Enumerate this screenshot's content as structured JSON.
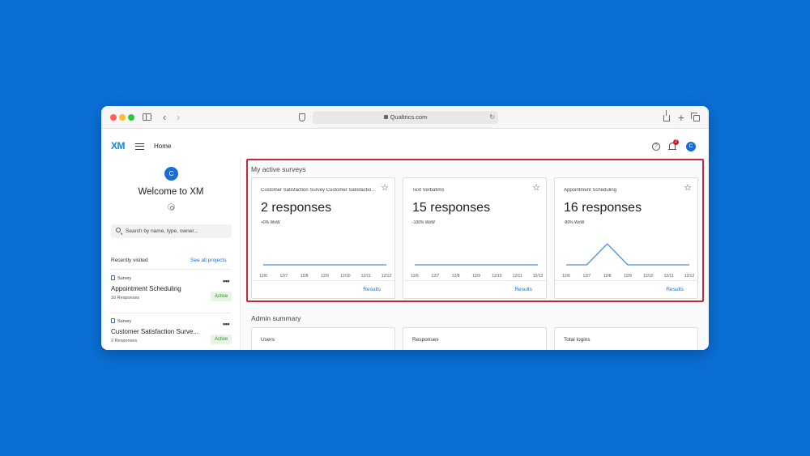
{
  "browser": {
    "url": "Qualtrics.com",
    "icons": [
      "sidebar-toggle-icon",
      "back-icon",
      "forward-icon",
      "shield-icon",
      "lock-icon",
      "reload-icon",
      "share-icon",
      "plus-icon",
      "tabs-icon"
    ]
  },
  "header": {
    "logo": "XM",
    "nav_label": "Home",
    "notification_count": "2",
    "avatar_initial": "C"
  },
  "sidebar": {
    "avatar_initial": "C",
    "welcome": "Welcome to XM",
    "search_placeholder": "Search by name, type, owner...",
    "recent_label": "Recently visited",
    "see_all": "See all projects",
    "items": [
      {
        "type": "Survey",
        "name": "Appointment Scheduling",
        "responses": "16 Responses",
        "status": "Active"
      },
      {
        "type": "Survey",
        "name": "Customer Satisfaction Surve...",
        "responses": "2 Responses",
        "status": "Active"
      }
    ]
  },
  "active_surveys": {
    "title": "My active surveys",
    "results_label": "Results",
    "cards": [
      {
        "name": "Customer Satisfaction Survey Customer Satisfaction Survey",
        "responses": "2 responses",
        "wow": "+0% WoW"
      },
      {
        "name": "Text Verbatims",
        "responses": "15 responses",
        "wow": "-100% WoW"
      },
      {
        "name": "Appointment Scheduling",
        "responses": "16 responses",
        "wow": "-80% WoW"
      }
    ]
  },
  "chart_data": [
    {
      "type": "line",
      "x": [
        "12/6",
        "12/7",
        "12/8",
        "12/9",
        "12/10",
        "12/11",
        "12/12"
      ],
      "series": [
        {
          "values": [
            0,
            0,
            0,
            0,
            0,
            0,
            0
          ]
        }
      ],
      "color": "#4a90d9"
    },
    {
      "type": "line",
      "x": [
        "12/6",
        "12/7",
        "12/8",
        "12/9",
        "12/10",
        "12/11",
        "12/12"
      ],
      "series": [
        {
          "values": [
            0,
            0,
            0,
            0,
            0,
            0,
            0
          ]
        }
      ],
      "color": "#4a90d9"
    },
    {
      "type": "line",
      "x": [
        "12/6",
        "12/7",
        "12/8",
        "12/9",
        "12/10",
        "12/11",
        "12/12"
      ],
      "series": [
        {
          "values": [
            0,
            0,
            1,
            0,
            0,
            0,
            0
          ]
        }
      ],
      "color": "#4a90d9"
    }
  ],
  "admin_summary": {
    "title": "Admin summary",
    "cards": [
      "Users",
      "Responses",
      "Total logins"
    ]
  }
}
